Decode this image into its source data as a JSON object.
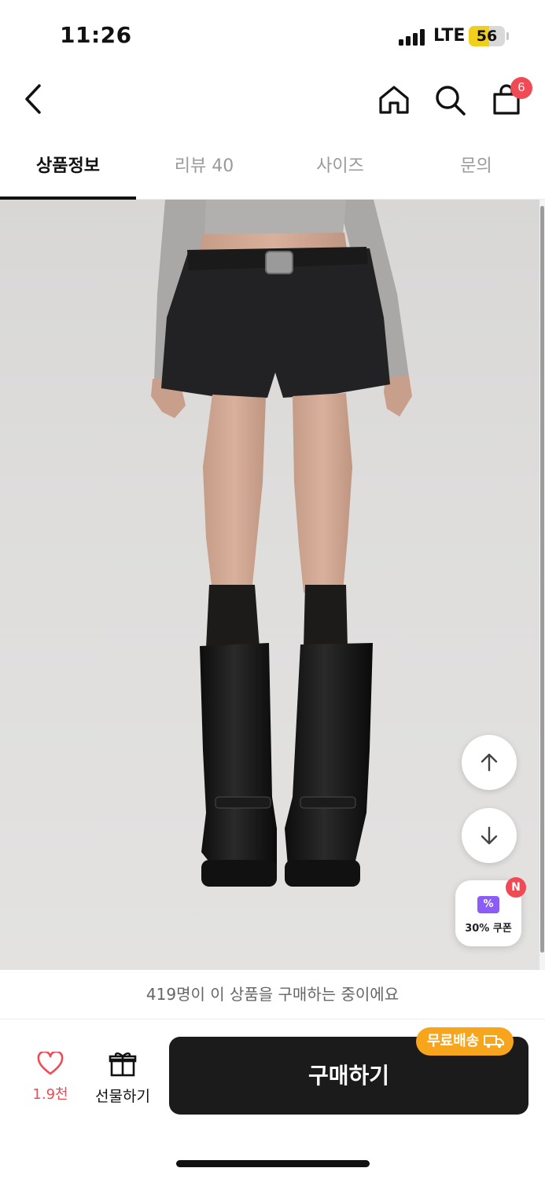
{
  "status_bar": {
    "time": "11:26",
    "network": "LTE",
    "battery": "56",
    "battery_level": 0.56
  },
  "header": {
    "back_icon": "chevron-left-icon",
    "home_icon": "home-icon",
    "search_icon": "search-icon",
    "cart_icon": "shopping-bag-icon",
    "cart_count": "6"
  },
  "tabs": [
    {
      "label": "상품정보",
      "active": true
    },
    {
      "label": "리뷰 40",
      "active": false
    },
    {
      "label": "사이즈",
      "active": false
    },
    {
      "label": "문의",
      "active": false
    }
  ],
  "floating": {
    "up_icon": "arrow-up-icon",
    "down_icon": "arrow-down-icon",
    "coupon_label": "30% 쿠폰",
    "coupon_badge": "N",
    "coupon_icon_glyph": "%"
  },
  "purchasing_notice": "419명이 이 상품을 구매하는 중이에요",
  "bottom_bar": {
    "like_count": "1.9천",
    "gift_label": "선물하기",
    "buy_label": "구매하기",
    "free_shipping_label": "무료배송"
  },
  "colors": {
    "accent_red": "#f04a54",
    "buy_button": "#1b1b1b",
    "free_ship": "#f7a51d",
    "coupon_purple": "#8b5cf6"
  }
}
